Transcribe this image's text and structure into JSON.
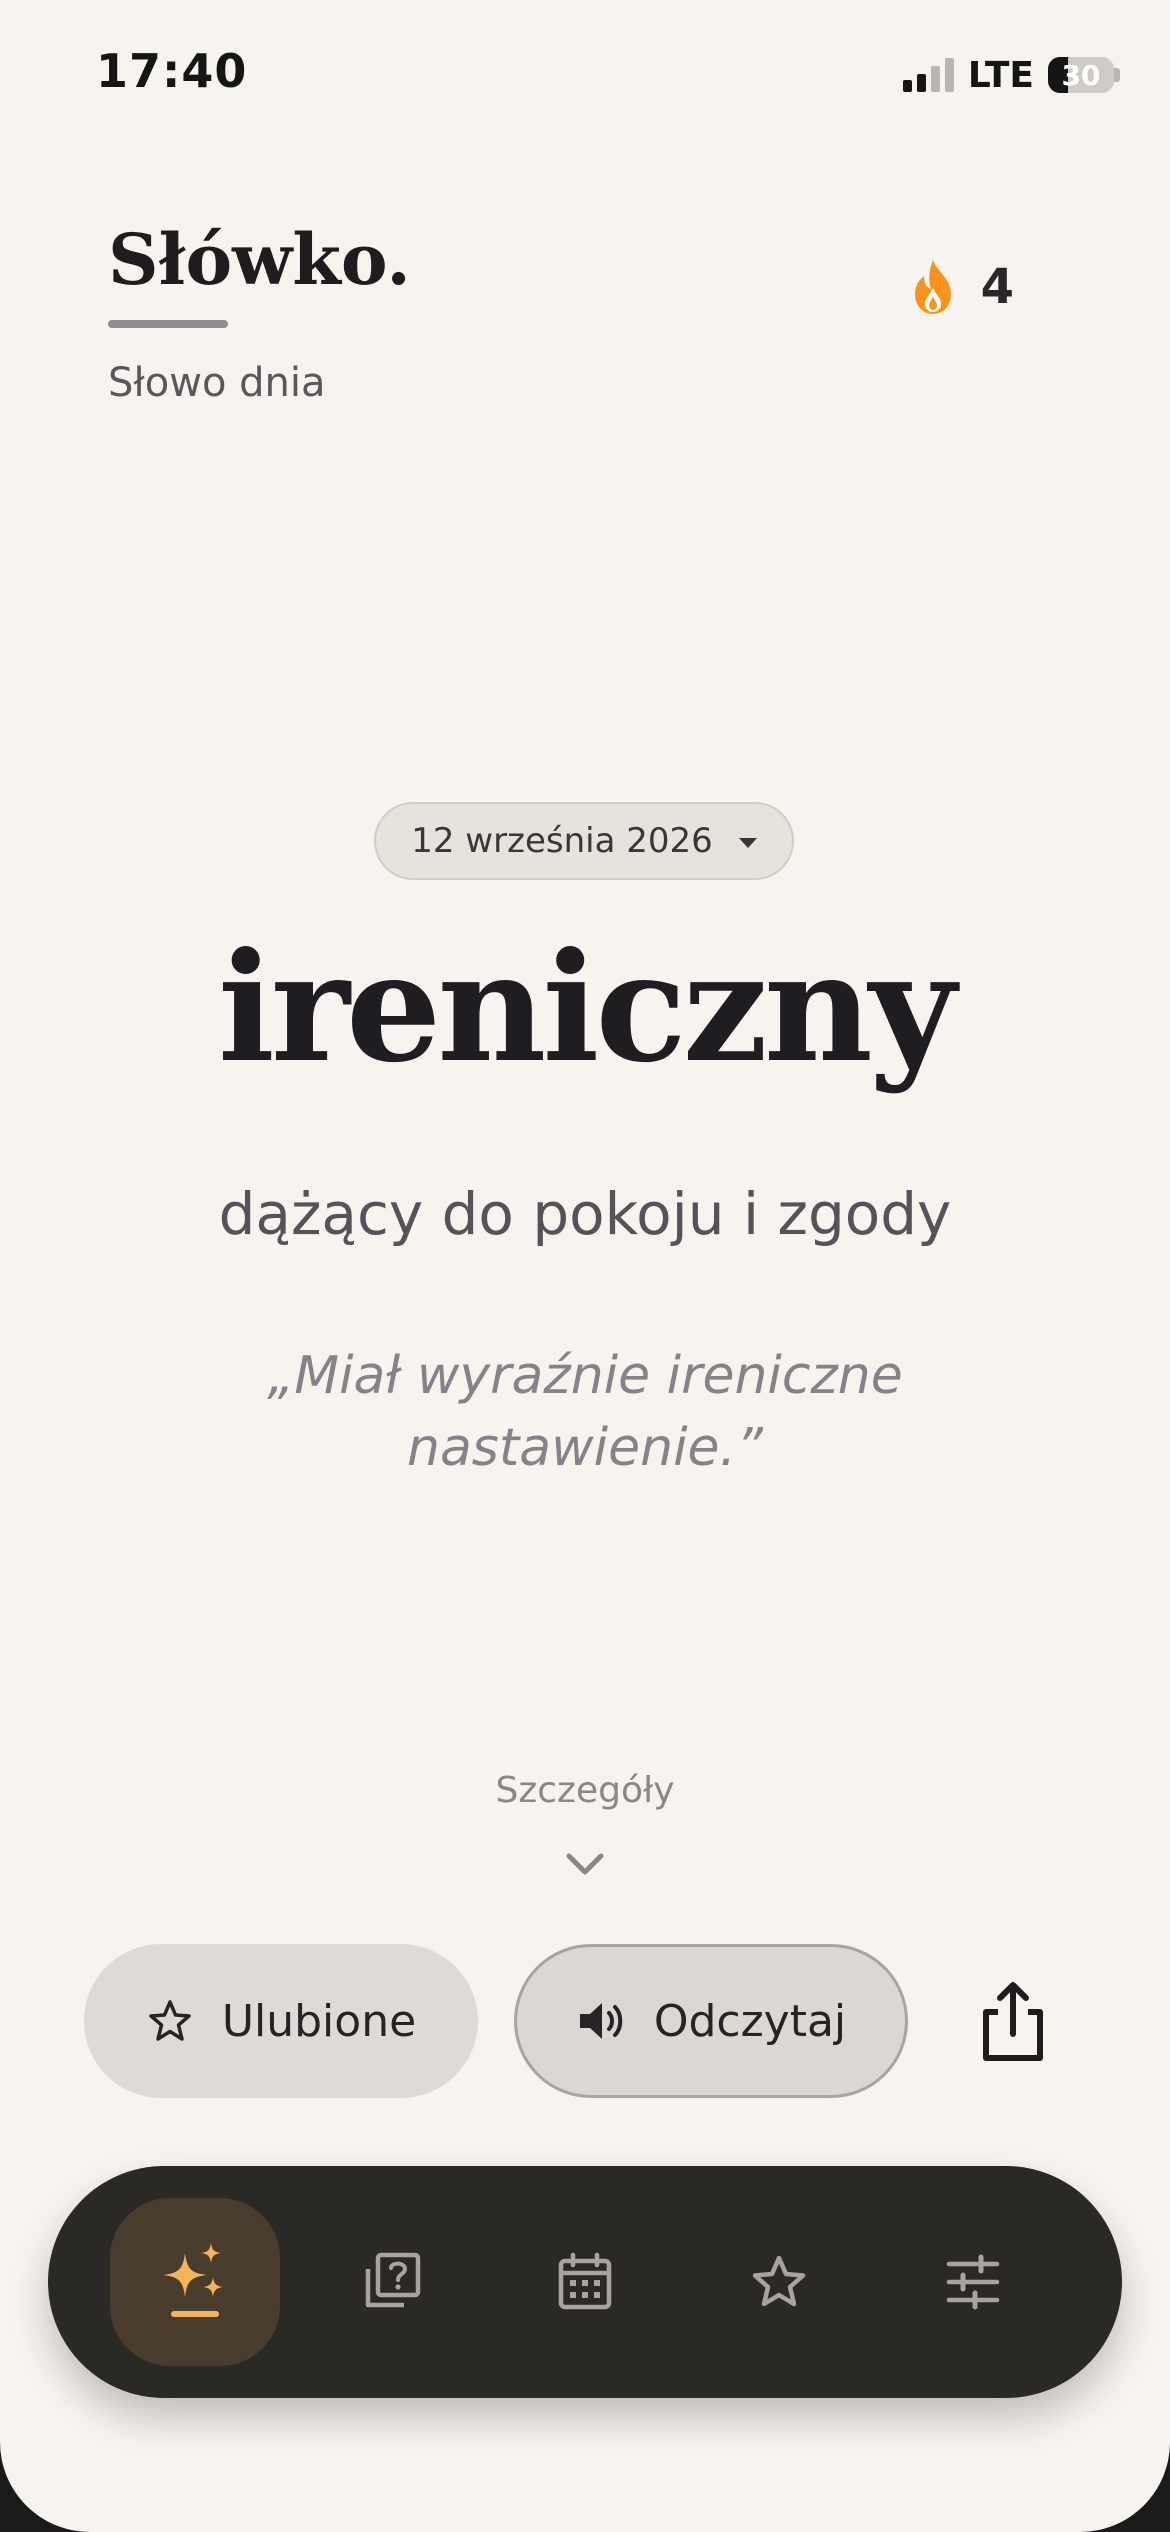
{
  "status_bar": {
    "time": "17:40",
    "network": "LTE",
    "battery": "30"
  },
  "header": {
    "brand": "Słówko.",
    "subtitle": "Słowo dnia",
    "streak_count": "4"
  },
  "word_of_day": {
    "date": "12 września 2026",
    "word": "ireniczny",
    "definition": "dążący do pokoju i zgody",
    "example": "„Miał wyraźnie ireniczne nastawienie.”"
  },
  "details_label": "Szczegóły",
  "actions": {
    "favorite_label": "Ulubione",
    "read_label": "Odczytaj"
  },
  "bottom_nav": {
    "items": [
      {
        "icon": "sparkles-icon",
        "active": true
      },
      {
        "icon": "quiz-icon",
        "active": false
      },
      {
        "icon": "calendar-icon",
        "active": false
      },
      {
        "icon": "star-icon",
        "active": false
      },
      {
        "icon": "sliders-icon",
        "active": false
      }
    ]
  },
  "colors": {
    "background": "#f7f3ee",
    "accent": "#f5b35a",
    "flame": "#f7941d",
    "nav_bg": "#2b2926",
    "nav_icon": "#a8a39c"
  }
}
